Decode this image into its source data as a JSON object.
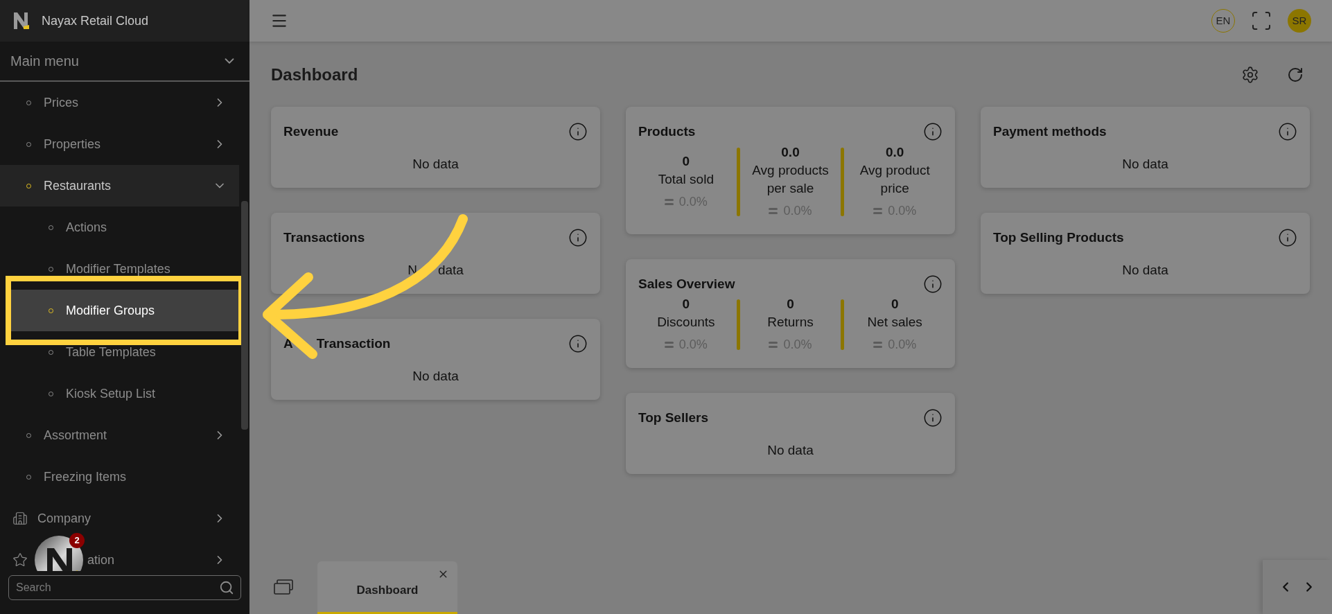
{
  "app": {
    "title": "Nayax Retail Cloud"
  },
  "sidebar": {
    "section": "Main menu",
    "items": [
      {
        "label": "Prices",
        "kind": "group",
        "active": false,
        "expanded": false
      },
      {
        "label": "Properties",
        "kind": "group",
        "active": false,
        "expanded": false
      },
      {
        "label": "Restaurants",
        "kind": "group",
        "active": true,
        "expanded": true,
        "children": [
          {
            "label": "Actions",
            "selected": false
          },
          {
            "label": "Modifier Templates",
            "selected": false
          },
          {
            "label": "Modifier Groups",
            "selected": true
          },
          {
            "label": "Table Templates",
            "selected": false
          },
          {
            "label": "Kiosk Setup List",
            "selected": false
          }
        ]
      },
      {
        "label": "Assortment",
        "kind": "group",
        "active": false,
        "expanded": false
      },
      {
        "label": "Freezing Items",
        "kind": "link",
        "active": false
      },
      {
        "label": "Company",
        "kind": "building",
        "expanded": false
      },
      {
        "label": "ation",
        "kind": "star",
        "expanded": false
      }
    ],
    "search": {
      "placeholder": "Search"
    },
    "chat_badge": "2"
  },
  "topbar": {
    "language": "EN",
    "avatar": "SR"
  },
  "dashboard": {
    "title": "Dashboard",
    "columns": [
      [
        {
          "title": "Revenue",
          "kind": "message",
          "message": "No data"
        },
        {
          "title": "Transactions",
          "kind": "message",
          "message": "N",
          "message_rest": "data"
        },
        {
          "title": "A",
          "title_rest": "Transaction",
          "kind": "message",
          "message": "No data"
        }
      ],
      [
        {
          "title": "Products",
          "kind": "stats",
          "stats": [
            {
              "value": "0",
              "label": "Total sold",
              "change": "0.0%"
            },
            {
              "value": "0.0",
              "label": "Avg products per sale",
              "change": "0.0%"
            },
            {
              "value": "0.0",
              "label": "Avg product price",
              "change": "0.0%"
            }
          ]
        },
        {
          "title": "Sales Overview",
          "kind": "stats",
          "stats": [
            {
              "value": "0",
              "label": "Discounts",
              "change": "0.0%"
            },
            {
              "value": "0",
              "label": "Returns",
              "change": "0.0%"
            },
            {
              "value": "0",
              "label": "Net sales",
              "change": "0.0%"
            }
          ]
        },
        {
          "title": "Top Sellers",
          "kind": "message",
          "message": "No data"
        }
      ],
      [
        {
          "title": "Payment methods",
          "kind": "message",
          "message": "No data"
        },
        {
          "title": "Top Selling Products",
          "kind": "message",
          "message": "No data"
        }
      ]
    ]
  },
  "tabs": [
    {
      "label": "Dashboard",
      "selected": true
    }
  ]
}
